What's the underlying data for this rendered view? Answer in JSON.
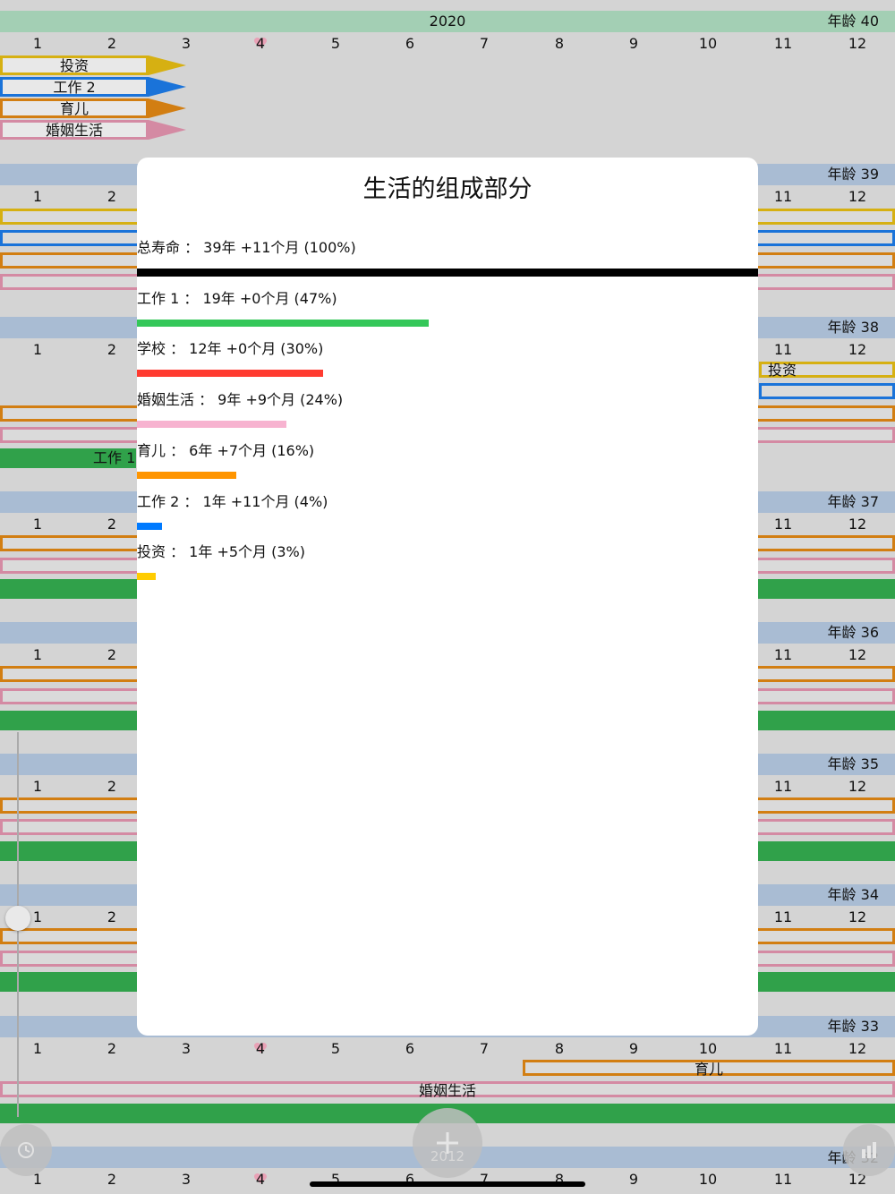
{
  "modal": {
    "title": "生活的组成部分",
    "items": [
      {
        "label": "总寿命 ： 39年 +11个月 (100%)",
        "percent": 100,
        "color": "#000000"
      },
      {
        "label": "工作 1 ： 19年 +0个月 (47%)",
        "percent": 47,
        "color": "#34c759"
      },
      {
        "label": "学校 ： 12年 +0个月 (30%)",
        "percent": 30,
        "color": "#ff3b30"
      },
      {
        "label": "婚姻生活 ： 9年 +9个月 (24%)",
        "percent": 24,
        "color": "#f7b3d0"
      },
      {
        "label": "育儿 ： 6年 +7个月 (16%)",
        "percent": 16,
        "color": "#ff9500"
      },
      {
        "label": "工作 2 ： 1年 +11个月 (4%)",
        "percent": 4,
        "color": "#007aff"
      },
      {
        "label": "投资 ： 1年 +5个月 (3%)",
        "percent": 3,
        "color": "#ffcc00"
      }
    ]
  },
  "timeline": {
    "months": [
      "1",
      "2",
      "3",
      "4",
      "5",
      "6",
      "7",
      "8",
      "9",
      "10",
      "11",
      "12"
    ],
    "heart_month": "4",
    "top_year": "2020",
    "age_prefix": "年龄",
    "legend": [
      {
        "label": "投资",
        "color": "#d6b012"
      },
      {
        "label": "工作 2",
        "color": "#1a73d9"
      },
      {
        "label": "育儿",
        "color": "#d27e12"
      },
      {
        "label": "婚姻生活",
        "color": "#d48aa3"
      }
    ],
    "rows": [
      {
        "age": "40",
        "year": "2020"
      },
      {
        "age": "39"
      },
      {
        "age": "38"
      },
      {
        "age": "37"
      },
      {
        "age": "36"
      },
      {
        "age": "35"
      },
      {
        "age": "34"
      },
      {
        "age": "33"
      },
      {
        "age": "32"
      }
    ],
    "bar_labels": {
      "investment": "投资",
      "work1": "工作 1",
      "childcare": "育儿",
      "marriage": "婚姻生活"
    },
    "colors": {
      "green_band": "#a3cfb4",
      "blue_band": "#a9bcd3",
      "investment": "#d6b012",
      "work2": "#1a73d9",
      "childcare": "#d27e12",
      "marriage": "#d48aa3",
      "work1": "#30a14a"
    }
  },
  "fab": {
    "year": "2012"
  }
}
